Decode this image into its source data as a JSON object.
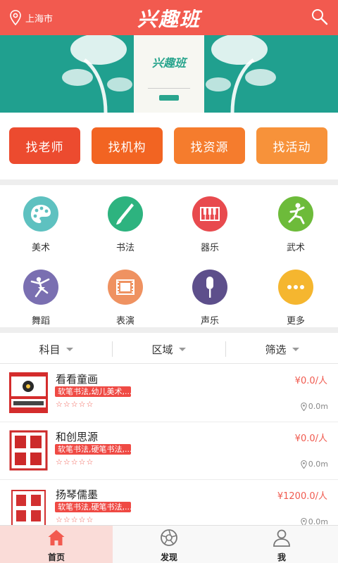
{
  "header": {
    "location": "上海市",
    "logo": "兴趣班"
  },
  "banner": {
    "title": "兴趣班"
  },
  "quick_actions": [
    "找老师",
    "找机构",
    "找资源",
    "找活动"
  ],
  "categories": [
    {
      "label": "美术",
      "icon": "palette-icon",
      "color": "#5ec1c0"
    },
    {
      "label": "书法",
      "icon": "brush-icon",
      "color": "#2db37f"
    },
    {
      "label": "器乐",
      "icon": "piano-icon",
      "color": "#e84a4e"
    },
    {
      "label": "武术",
      "icon": "martial-arts-icon",
      "color": "#6dbb3a"
    },
    {
      "label": "舞蹈",
      "icon": "dance-icon",
      "color": "#7a6fb1"
    },
    {
      "label": "表演",
      "icon": "film-icon",
      "color": "#ef9261"
    },
    {
      "label": "声乐",
      "icon": "microphone-icon",
      "color": "#5d4f8b"
    },
    {
      "label": "更多",
      "icon": "more-icon",
      "color": "#f5b62f"
    }
  ],
  "filters": [
    "科目",
    "区域",
    "筛选"
  ],
  "listings": [
    {
      "name": "看看童画",
      "tags": "软笔书法,幼儿美术,...",
      "stars": "☆☆☆☆☆",
      "price": "¥0.0/人",
      "distance": "0.0m"
    },
    {
      "name": "和创思源",
      "tags": "软笔书法,硬笔书法,...",
      "stars": "☆☆☆☆☆",
      "price": "¥0.0/人",
      "distance": "0.0m"
    },
    {
      "name": "扬琴儒墨",
      "tags": "软笔书法,硬笔书法,...",
      "stars": "☆☆☆☆☆",
      "price": "¥1200.0/人",
      "distance": "0.0m"
    }
  ],
  "tabs": [
    {
      "label": "首页",
      "icon": "home-icon",
      "active": true
    },
    {
      "label": "发现",
      "icon": "aperture-icon",
      "active": false
    },
    {
      "label": "我",
      "icon": "user-icon",
      "active": false
    }
  ],
  "colors": {
    "header": "#f25a4f",
    "banner": "#20a08f",
    "accent": "#f05a4f",
    "tab_active_bg": "#fadcd8"
  }
}
